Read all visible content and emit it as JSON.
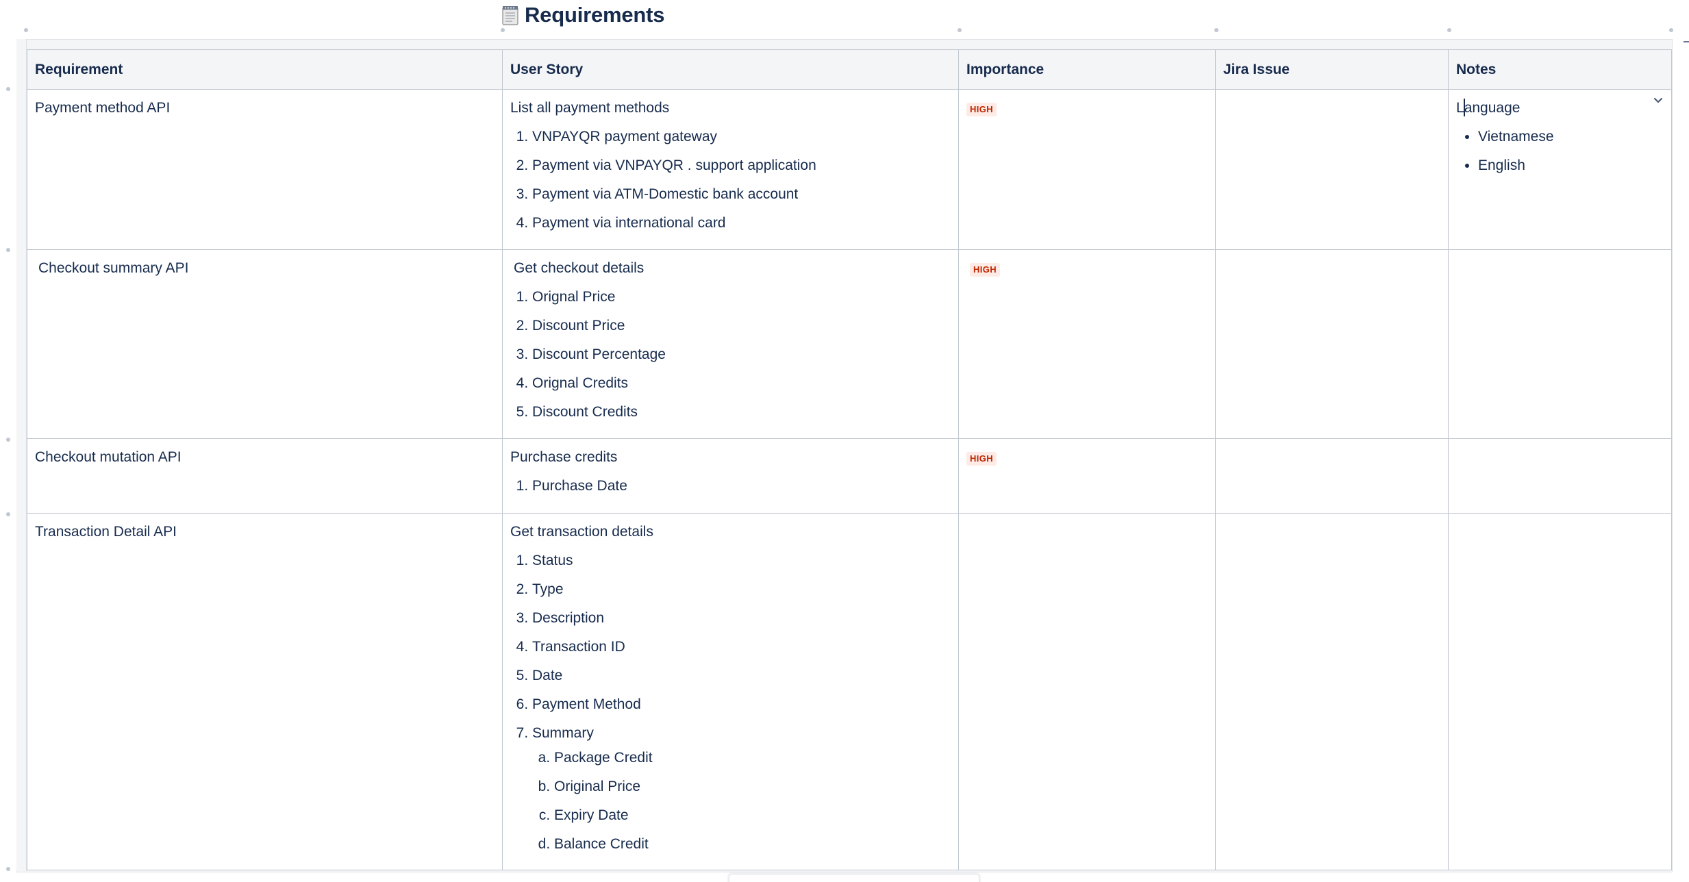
{
  "page": {
    "title": "Requirements",
    "title_icon": "memo-icon"
  },
  "table": {
    "headers": [
      "Requirement",
      "User Story",
      "Importance",
      "Jira Issue",
      "Notes"
    ],
    "rows": [
      {
        "requirement": "Payment method API",
        "story_title": "List all payment methods",
        "story_items": [
          "VNPAYQR payment gateway",
          "Payment via VNPAYQR . support application",
          "Payment via ATM-Domestic bank account",
          "Payment via international card"
        ],
        "importance": "HIGH",
        "jira": "",
        "notes_title_pre": "L",
        "notes_title_post": "anguage",
        "notes_items": [
          "Vietnamese",
          "English"
        ]
      },
      {
        "requirement": "Checkout summary API",
        "story_title": "Get checkout details",
        "story_items": [
          "Orignal Price",
          "Discount Price",
          "Discount Percentage",
          "Orignal Credits",
          "Discount Credits"
        ],
        "importance": "HIGH",
        "jira": "",
        "notes": ""
      },
      {
        "requirement": "Checkout mutation API",
        "story_title": "Purchase credits",
        "story_items": [
          "Purchase Date"
        ],
        "importance": "HIGH",
        "jira": "",
        "notes": ""
      },
      {
        "requirement": "Transaction Detail API",
        "story_title": "Get transaction details",
        "story_items": [
          "Status",
          "Type",
          "Description",
          "Transaction ID",
          "Date",
          "Payment Method",
          "Summary"
        ],
        "story_subitems": [
          "Package Credit",
          "Original Price",
          "Expiry Date",
          "Balance Credit"
        ],
        "importance": "",
        "jira": "",
        "notes": ""
      }
    ]
  },
  "colors": {
    "text": "#172b4d",
    "header_bg": "#f4f5f7",
    "border": "#c1c7d0",
    "lozenge_bg": "#ffebe6",
    "lozenge_text": "#bf2600"
  },
  "icons": {
    "cell_menu": "chevron-down-icon"
  }
}
